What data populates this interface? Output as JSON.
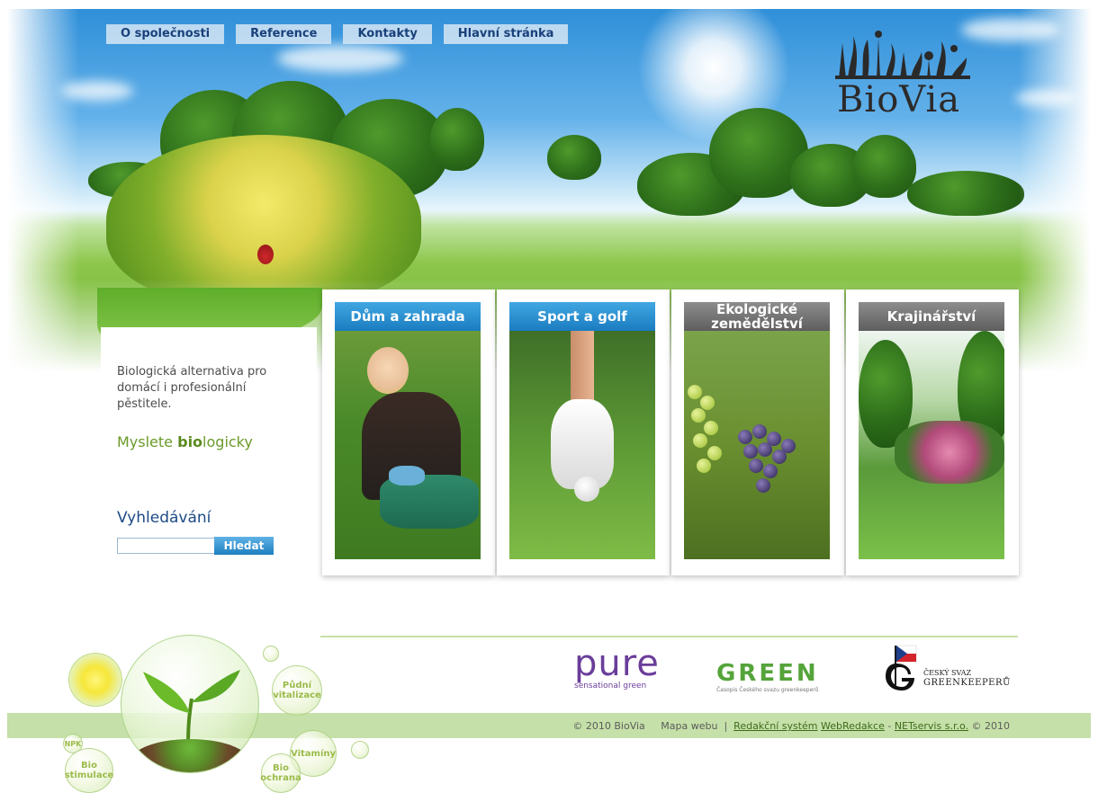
{
  "nav": {
    "items": [
      "O společnosti",
      "Reference",
      "Kontakty",
      "Hlavní stránka"
    ]
  },
  "logo": {
    "text": "BioVia"
  },
  "sidebar": {
    "tagline": "Biologická alternativa pro domácí i profesionální pěstitele.",
    "slogan_pre": "Myslete ",
    "slogan_bold": "bio",
    "slogan_post": "logicky",
    "search_title": "Vyhledávání",
    "search_value": "",
    "search_button": "Hledat"
  },
  "categories": [
    {
      "title": "Dům a zahrada",
      "color": "#2b8fd2"
    },
    {
      "title": "Sport a golf",
      "color": "#2b8fd2"
    },
    {
      "title": "Ekologické zemědělství",
      "color": "#767676"
    },
    {
      "title": "Krajinářství",
      "color": "#767676"
    }
  ],
  "partners": {
    "pure": {
      "name": "pure",
      "tagline": "sensational green"
    },
    "green": {
      "name": "GREEN",
      "tagline": "Časopis Českého svazu greenkeeperů"
    },
    "csg": {
      "line1": "ČESKÝ SVAZ",
      "line2": "GREENKEEPERŮ"
    }
  },
  "bubbles": {
    "npk": "NPK",
    "bio_stimulace": "Bio stimulace",
    "pudni_vitalizace": "Půdní vitalizace",
    "vitaminy": "Vitamíny",
    "bio_ochrana": "Bio ochrana"
  },
  "footer": {
    "copyright": "© 2010 BioVia",
    "sitemap": "Mapa webu",
    "separator": "|",
    "cms_label": "Redakční systém",
    "cms_name": "WebRedakce",
    "dash": "-",
    "vendor": "NETservis s.r.o.",
    "vendor_year": "© 2010"
  }
}
